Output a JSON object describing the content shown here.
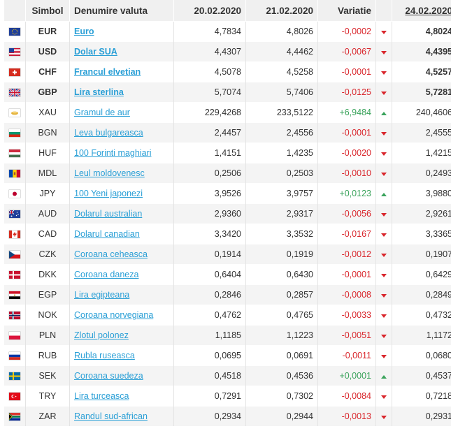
{
  "header": {
    "symbol": "Simbol",
    "name": "Denumire valuta",
    "date1": "20.02.2020",
    "date2": "21.02.2020",
    "variation": "Variatie",
    "date3": "24.02.2020"
  },
  "rows": [
    {
      "flag": "eu",
      "symbol": "EUR",
      "name": "Euro",
      "v1": "4,7834",
      "v2": "4,8026",
      "var": "-0,0002",
      "trend": "down",
      "v3": "4,8024",
      "bold": true
    },
    {
      "flag": "us",
      "symbol": "USD",
      "name": "Dolar SUA",
      "v1": "4,4307",
      "v2": "4,4462",
      "var": "-0,0067",
      "trend": "down",
      "v3": "4,4395",
      "bold": true
    },
    {
      "flag": "ch",
      "symbol": "CHF",
      "name": "Francul elvetian",
      "v1": "4,5078",
      "v2": "4,5258",
      "var": "-0,0001",
      "trend": "down",
      "v3": "4,5257",
      "bold": true
    },
    {
      "flag": "gb",
      "symbol": "GBP",
      "name": "Lira sterlina",
      "v1": "5,7074",
      "v2": "5,7406",
      "var": "-0,0125",
      "trend": "down",
      "v3": "5,7281",
      "bold": true
    },
    {
      "flag": "xau",
      "symbol": "XAU",
      "name": "Gramul de aur",
      "v1": "229,4268",
      "v2": "233,5122",
      "var": "+6,9484",
      "trend": "up",
      "v3": "240,4606",
      "bold": false
    },
    {
      "flag": "bg",
      "symbol": "BGN",
      "name": "Leva bulgareasca",
      "v1": "2,4457",
      "v2": "2,4556",
      "var": "-0,0001",
      "trend": "down",
      "v3": "2,4555",
      "bold": false
    },
    {
      "flag": "hu",
      "symbol": "HUF",
      "name": "100 Forinti maghiari",
      "v1": "1,4151",
      "v2": "1,4235",
      "var": "-0,0020",
      "trend": "down",
      "v3": "1,4215",
      "bold": false
    },
    {
      "flag": "md",
      "symbol": "MDL",
      "name": "Leul moldovenesc",
      "v1": "0,2506",
      "v2": "0,2503",
      "var": "-0,0010",
      "trend": "down",
      "v3": "0,2493",
      "bold": false
    },
    {
      "flag": "jp",
      "symbol": "JPY",
      "name": "100 Yeni japonezi",
      "v1": "3,9526",
      "v2": "3,9757",
      "var": "+0,0123",
      "trend": "up",
      "v3": "3,9880",
      "bold": false
    },
    {
      "flag": "au",
      "symbol": "AUD",
      "name": "Dolarul australian",
      "v1": "2,9360",
      "v2": "2,9317",
      "var": "-0,0056",
      "trend": "down",
      "v3": "2,9261",
      "bold": false
    },
    {
      "flag": "ca",
      "symbol": "CAD",
      "name": "Dolarul canadian",
      "v1": "3,3420",
      "v2": "3,3532",
      "var": "-0,0167",
      "trend": "down",
      "v3": "3,3365",
      "bold": false
    },
    {
      "flag": "cz",
      "symbol": "CZK",
      "name": "Coroana ceheasca",
      "v1": "0,1914",
      "v2": "0,1919",
      "var": "-0,0012",
      "trend": "down",
      "v3": "0,1907",
      "bold": false
    },
    {
      "flag": "dk",
      "symbol": "DKK",
      "name": "Coroana daneza",
      "v1": "0,6404",
      "v2": "0,6430",
      "var": "-0,0001",
      "trend": "down",
      "v3": "0,6429",
      "bold": false
    },
    {
      "flag": "eg",
      "symbol": "EGP",
      "name": "Lira egipteana",
      "v1": "0,2846",
      "v2": "0,2857",
      "var": "-0,0008",
      "trend": "down",
      "v3": "0,2849",
      "bold": false
    },
    {
      "flag": "no",
      "symbol": "NOK",
      "name": "Coroana norvegiana",
      "v1": "0,4762",
      "v2": "0,4765",
      "var": "-0,0033",
      "trend": "down",
      "v3": "0,4732",
      "bold": false
    },
    {
      "flag": "pl",
      "symbol": "PLN",
      "name": "Zlotul polonez",
      "v1": "1,1185",
      "v2": "1,1223",
      "var": "-0,0051",
      "trend": "down",
      "v3": "1,1172",
      "bold": false
    },
    {
      "flag": "ru",
      "symbol": "RUB",
      "name": "Rubla ruseasca",
      "v1": "0,0695",
      "v2": "0,0691",
      "var": "-0,0011",
      "trend": "down",
      "v3": "0,0680",
      "bold": false
    },
    {
      "flag": "se",
      "symbol": "SEK",
      "name": "Coroana suedeza",
      "v1": "0,4518",
      "v2": "0,4536",
      "var": "+0,0001",
      "trend": "up",
      "v3": "0,4537",
      "bold": false
    },
    {
      "flag": "tr",
      "symbol": "TRY",
      "name": "Lira turceasca",
      "v1": "0,7291",
      "v2": "0,7302",
      "var": "-0,0084",
      "trend": "down",
      "v3": "0,7218",
      "bold": false
    },
    {
      "flag": "za",
      "symbol": "ZAR",
      "name": "Randul sud-african",
      "v1": "0,2934",
      "v2": "0,2944",
      "var": "-0,0013",
      "trend": "down",
      "v3": "0,2931",
      "bold": false
    }
  ]
}
